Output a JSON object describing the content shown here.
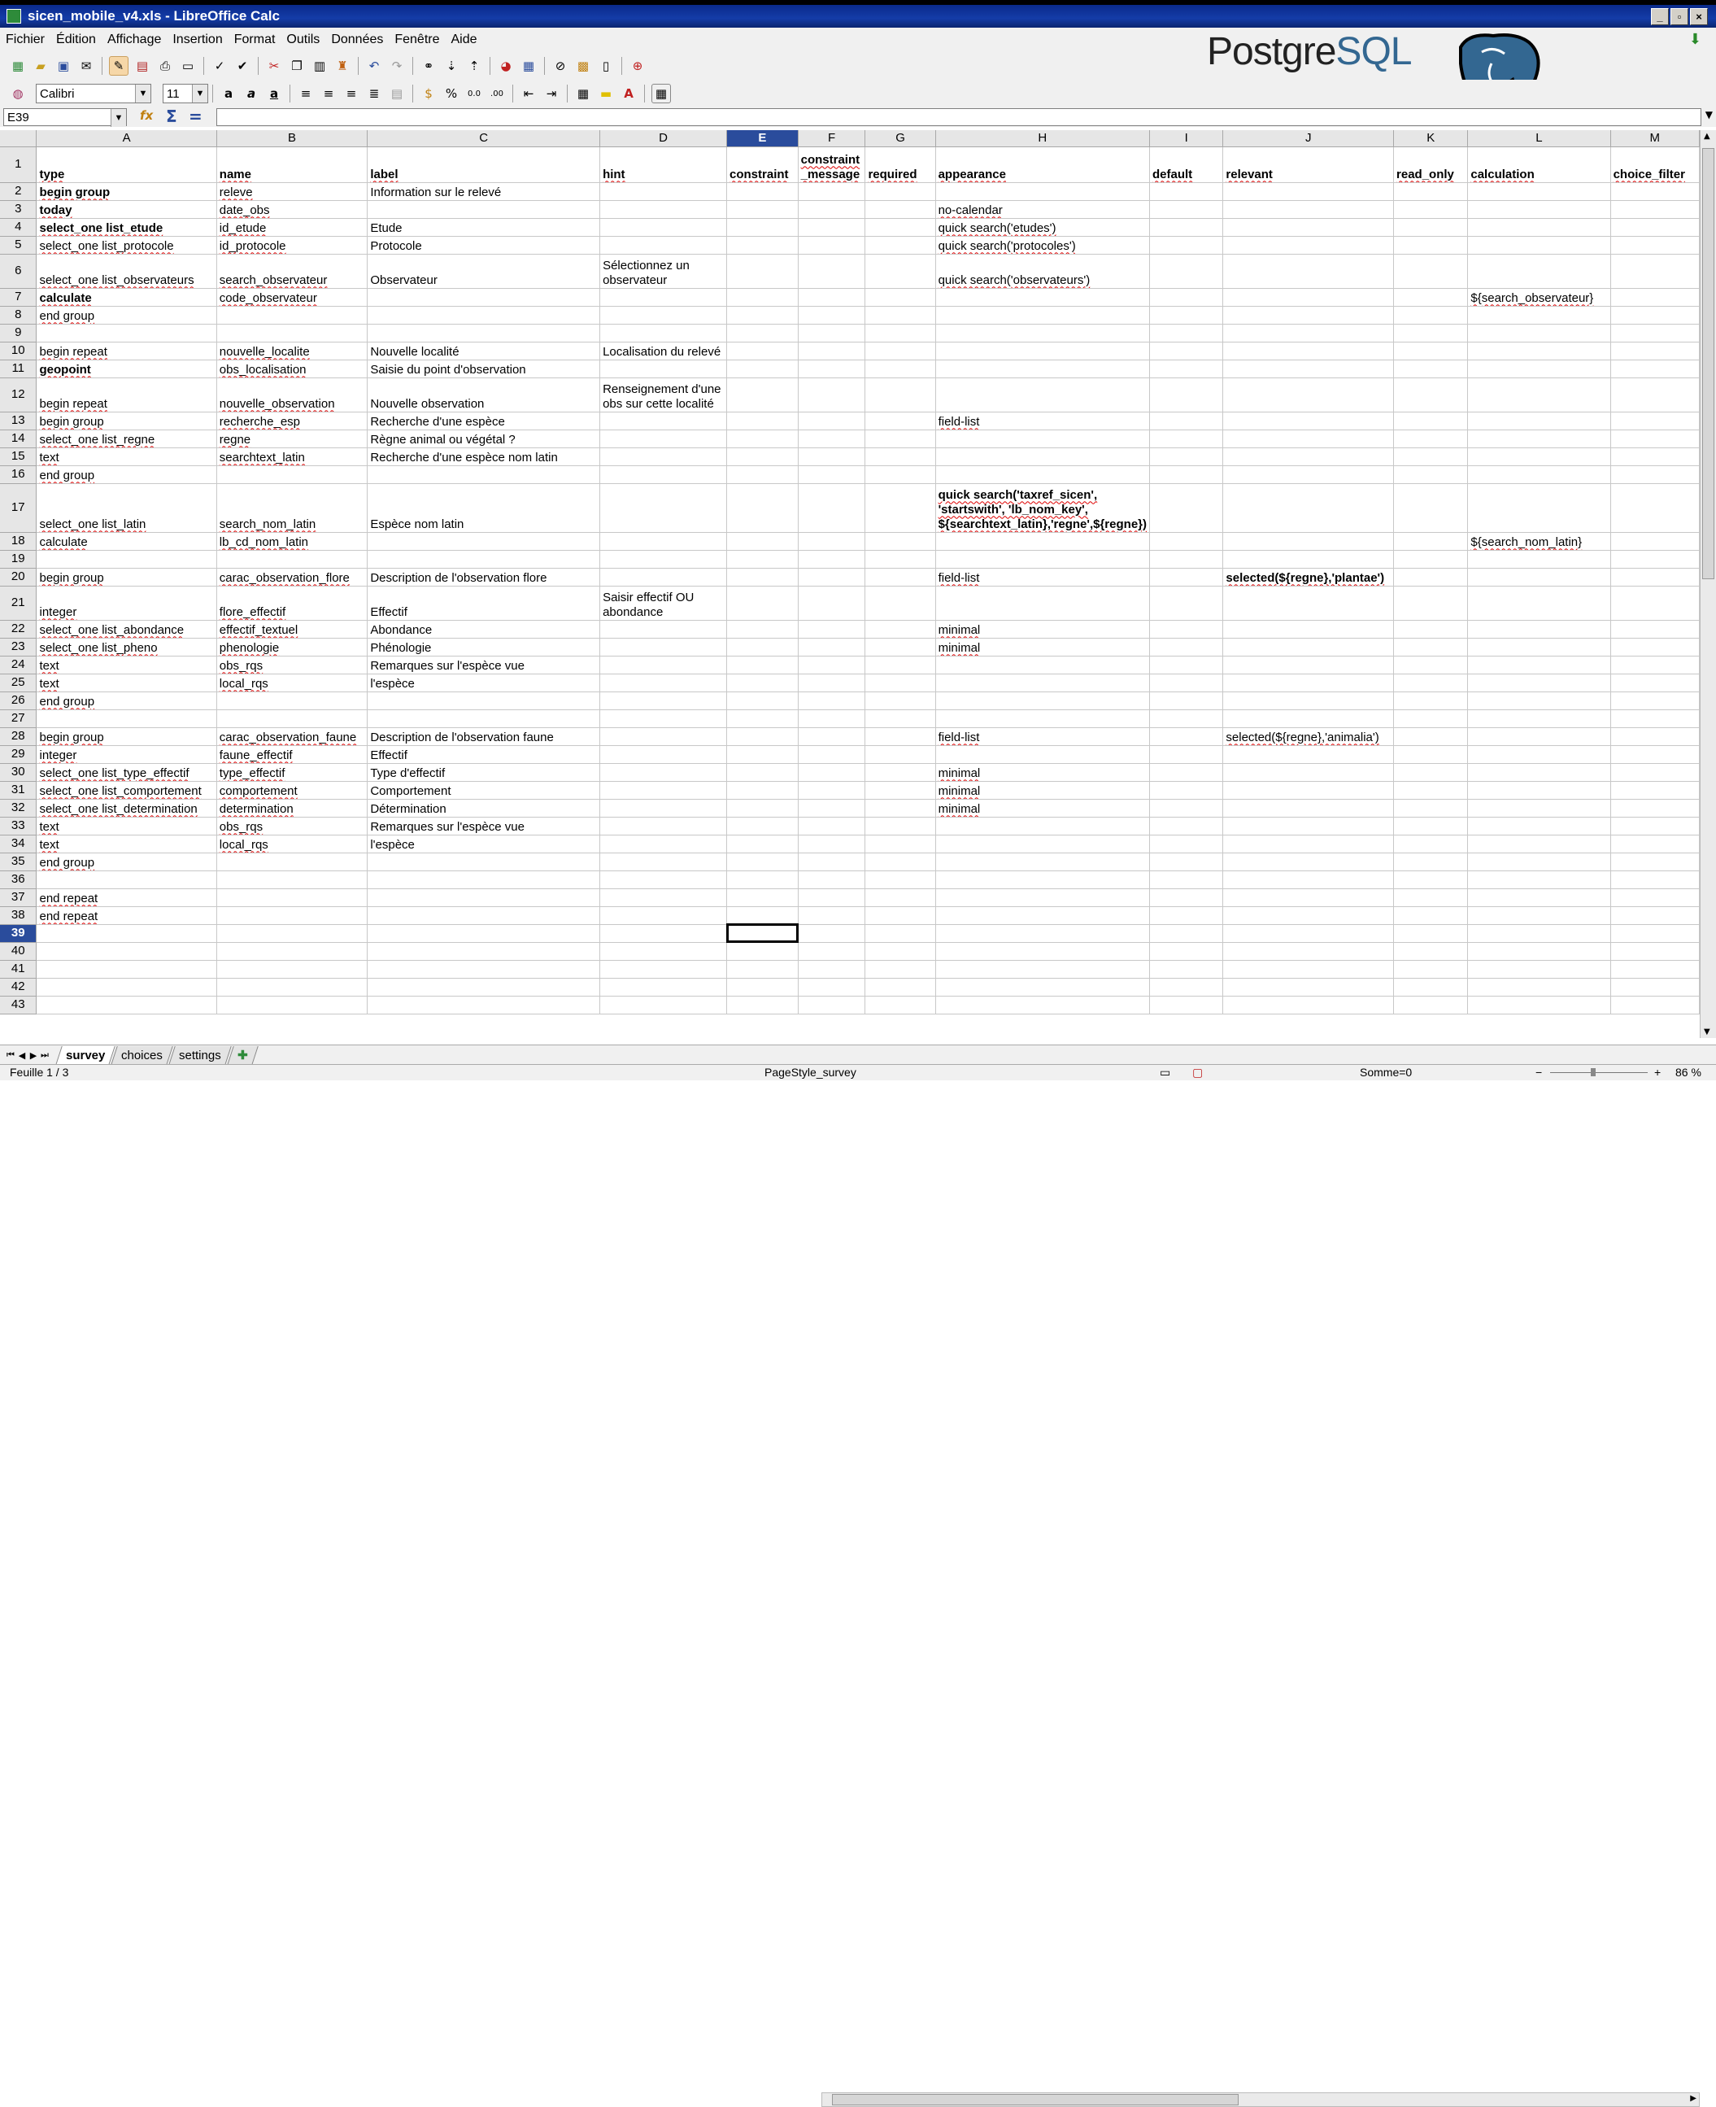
{
  "window": {
    "title": "sicen_mobile_v4.xls - LibreOffice Calc"
  },
  "menu": [
    "Fichier",
    "Édition",
    "Affichage",
    "Insertion",
    "Format",
    "Outils",
    "Données",
    "Fenêtre",
    "Aide"
  ],
  "logo": {
    "part1": "Postgre",
    "part2": "SQL"
  },
  "format": {
    "font_name": "Calibri",
    "font_size": "11"
  },
  "formula_bar": {
    "cell_ref": "E39",
    "content": ""
  },
  "sheet": {
    "columns": [
      "A",
      "B",
      "C",
      "D",
      "E",
      "F",
      "G",
      "H",
      "I",
      "J",
      "K",
      "L",
      "M"
    ],
    "selected_column": "E",
    "selected_row": "39",
    "headers": [
      "type",
      "name",
      "label",
      "hint",
      "constraint",
      "constraint\n_message",
      "required",
      "appearance",
      "default",
      "relevant",
      "read_only",
      "calculation",
      "choice_filter"
    ],
    "rows": [
      [
        "begin group",
        "releve",
        "Information sur le relevé",
        "",
        "",
        "",
        "",
        "",
        "",
        "",
        "",
        "",
        ""
      ],
      [
        "today",
        "date_obs",
        "",
        "",
        "",
        "",
        "",
        "no-calendar",
        "",
        "",
        "",
        "",
        ""
      ],
      [
        "select_one list_etude",
        "id_etude",
        "Etude",
        "",
        "",
        "",
        "",
        "quick search('etudes')",
        "",
        "",
        "",
        "",
        ""
      ],
      [
        "select_one list_protocole",
        "id_protocole",
        "Protocole",
        "",
        "",
        "",
        "",
        "quick search('protocoles')",
        "",
        "",
        "",
        "",
        ""
      ],
      [
        "select_one list_observateurs",
        "search_observateur",
        "Observateur",
        "Sélectionnez un observateur",
        "",
        "",
        "",
        "quick search('observateurs')",
        "",
        "",
        "",
        "",
        ""
      ],
      [
        "calculate",
        "code_observateur",
        "",
        "",
        "",
        "",
        "",
        "",
        "",
        "",
        "",
        "${search_observateur}",
        ""
      ],
      [
        "end group",
        "",
        "",
        "",
        "",
        "",
        "",
        "",
        "",
        "",
        "",
        "",
        ""
      ],
      [
        "",
        "",
        "",
        "",
        "",
        "",
        "",
        "",
        "",
        "",
        "",
        "",
        ""
      ],
      [
        "begin repeat",
        "nouvelle_localite",
        "Nouvelle localité",
        "Localisation du relevé",
        "",
        "",
        "",
        "",
        "",
        "",
        "",
        "",
        ""
      ],
      [
        "geopoint",
        "obs_localisation",
        "Saisie du point d'observation",
        "",
        "",
        "",
        "",
        "",
        "",
        "",
        "",
        "",
        ""
      ],
      [
        "begin repeat",
        "nouvelle_observation",
        "Nouvelle observation",
        "Renseignement d'une obs sur cette localité",
        "",
        "",
        "",
        "",
        "",
        "",
        "",
        "",
        ""
      ],
      [
        "begin group",
        "recherche_esp",
        "Recherche d'une espèce",
        "",
        "",
        "",
        "",
        "field-list",
        "",
        "",
        "",
        "",
        ""
      ],
      [
        "select_one list_regne",
        "regne",
        "Règne animal ou végétal ?",
        "",
        "",
        "",
        "",
        "",
        "",
        "",
        "",
        "",
        ""
      ],
      [
        "text",
        "searchtext_latin",
        "Recherche d'une espèce nom latin",
        "",
        "",
        "",
        "",
        "",
        "",
        "",
        "",
        "",
        ""
      ],
      [
        "end group",
        "",
        "",
        "",
        "",
        "",
        "",
        "",
        "",
        "",
        "",
        "",
        ""
      ],
      [
        "select_one list_latin",
        "search_nom_latin",
        "Espèce nom latin",
        "",
        "",
        "",
        "",
        "quick search('taxref_sicen', 'startswith', 'lb_nom_key', ${searchtext_latin},'regne',${regne})",
        "",
        "",
        "",
        "",
        ""
      ],
      [
        "calculate",
        "lb_cd_nom_latin",
        "",
        "",
        "",
        "",
        "",
        "",
        "",
        "",
        "",
        "${search_nom_latin}",
        ""
      ],
      [
        "",
        "",
        "",
        "",
        "",
        "",
        "",
        "",
        "",
        "",
        "",
        "",
        ""
      ],
      [
        "begin group",
        "carac_observation_flore",
        "Description de l'observation flore",
        "",
        "",
        "",
        "",
        "field-list",
        "",
        "selected(${regne},'plantae')",
        "",
        "",
        ""
      ],
      [
        "integer",
        "flore_effectif",
        "Effectif",
        "Saisir effectif OU abondance",
        "",
        "",
        "",
        "",
        "",
        "",
        "",
        "",
        ""
      ],
      [
        "select_one list_abondance",
        "effectif_textuel",
        "Abondance",
        "",
        "",
        "",
        "",
        "minimal",
        "",
        "",
        "",
        "",
        ""
      ],
      [
        "select_one list_pheno",
        "phenologie",
        "Phénologie",
        "",
        "",
        "",
        "",
        "minimal",
        "",
        "",
        "",
        "",
        ""
      ],
      [
        "text",
        "obs_rqs",
        "Remarques sur l'espèce vue",
        "",
        "",
        "",
        "",
        "",
        "",
        "",
        "",
        "",
        ""
      ],
      [
        "text",
        "local_rqs",
        "l'espèce",
        "",
        "",
        "",
        "",
        "",
        "",
        "",
        "",
        "",
        ""
      ],
      [
        "end group",
        "",
        "",
        "",
        "",
        "",
        "",
        "",
        "",
        "",
        "",
        "",
        ""
      ],
      [
        "",
        "",
        "",
        "",
        "",
        "",
        "",
        "",
        "",
        "",
        "",
        "",
        ""
      ],
      [
        "begin group",
        "carac_observation_faune",
        "Description de l'observation faune",
        "",
        "",
        "",
        "",
        "field-list",
        "",
        "selected(${regne},'animalia')",
        "",
        "",
        ""
      ],
      [
        "integer",
        "faune_effectif",
        "Effectif",
        "",
        "",
        "",
        "",
        "",
        "",
        "",
        "",
        "",
        ""
      ],
      [
        "select_one list_type_effectif",
        "type_effectif",
        "Type d'effectif",
        "",
        "",
        "",
        "",
        "minimal",
        "",
        "",
        "",
        "",
        ""
      ],
      [
        "select_one list_comportement",
        "comportement",
        "Comportement",
        "",
        "",
        "",
        "",
        "minimal",
        "",
        "",
        "",
        "",
        ""
      ],
      [
        "select_one list_determination",
        "determination",
        "Détermination",
        "",
        "",
        "",
        "",
        "minimal",
        "",
        "",
        "",
        "",
        ""
      ],
      [
        "text",
        "obs_rqs",
        "Remarques sur l'espèce vue",
        "",
        "",
        "",
        "",
        "",
        "",
        "",
        "",
        "",
        ""
      ],
      [
        "text",
        "local_rqs",
        "l'espèce",
        "",
        "",
        "",
        "",
        "",
        "",
        "",
        "",
        "",
        ""
      ],
      [
        "end group",
        "",
        "",
        "",
        "",
        "",
        "",
        "",
        "",
        "",
        "",
        "",
        ""
      ],
      [
        "",
        "",
        "",
        "",
        "",
        "",
        "",
        "",
        "",
        "",
        "",
        "",
        ""
      ],
      [
        "end repeat",
        "",
        "",
        "",
        "",
        "",
        "",
        "",
        "",
        "",
        "",
        "",
        ""
      ],
      [
        "end repeat",
        "",
        "",
        "",
        "",
        "",
        "",
        "",
        "",
        "",
        "",
        "",
        ""
      ]
    ]
  },
  "tabs": [
    {
      "label": "survey",
      "active": true
    },
    {
      "label": "choices",
      "active": false
    },
    {
      "label": "settings",
      "active": false
    }
  ],
  "status": {
    "sheet": "Feuille 1 / 3",
    "page_style": "PageStyle_survey",
    "sum": "Somme=0",
    "zoom": "86 %"
  }
}
